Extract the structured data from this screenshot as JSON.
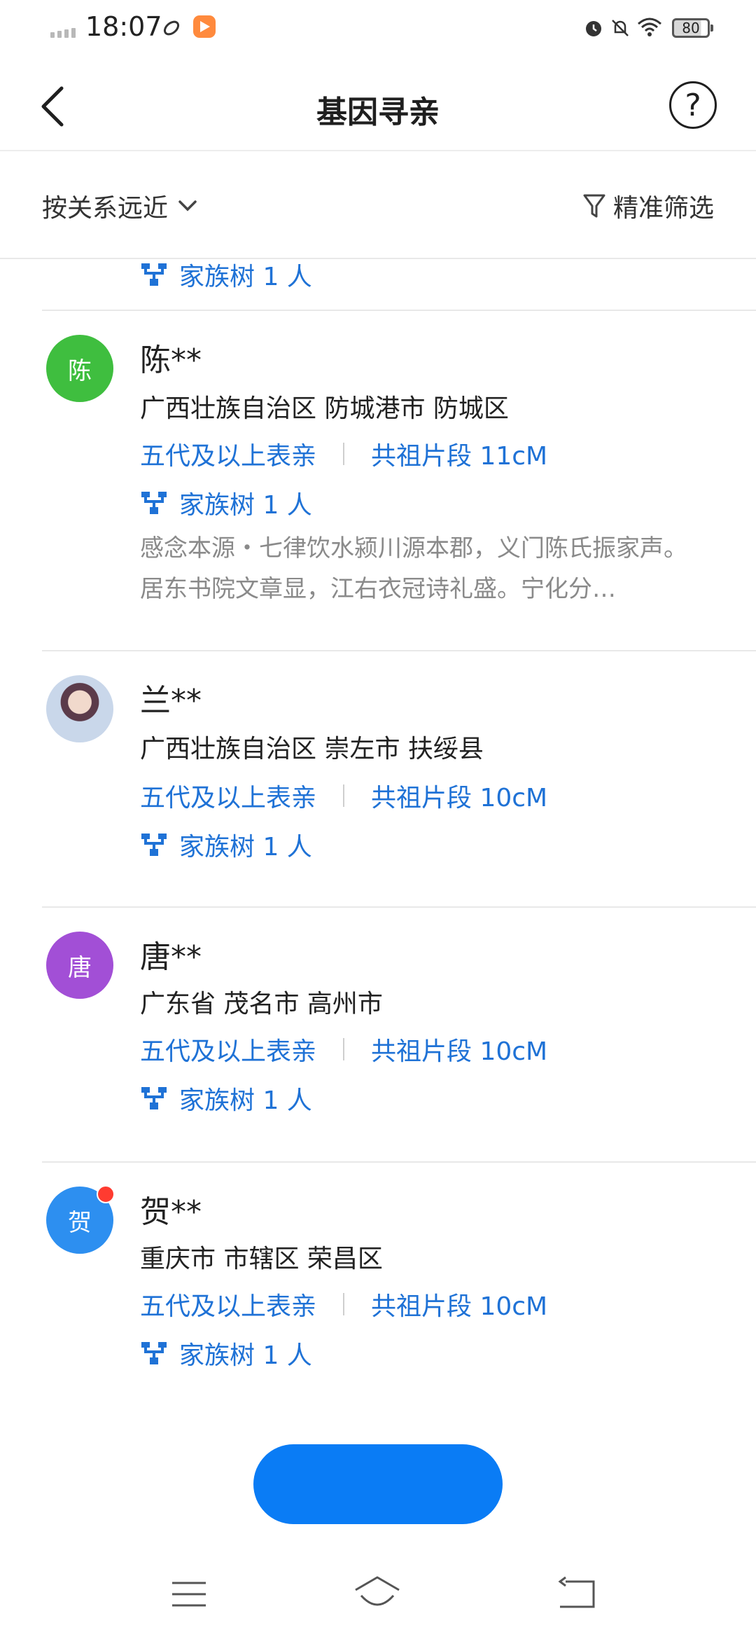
{
  "status_bar": {
    "time": "18:07",
    "battery": "80"
  },
  "header": {
    "title": "基因寻亲",
    "help": "?"
  },
  "filter_bar": {
    "sort_label": "按关系远近",
    "filter_label": "精准筛选"
  },
  "partial_row": {
    "tree_label": "家族树 1 人"
  },
  "matches": [
    {
      "avatar_text": "陈",
      "avatar_color": "#3fbe3f",
      "name": "陈**",
      "location": "广西壮族自治区 防城港市 防城区",
      "relation": "五代及以上表亲",
      "segment": "共祖片段 11cM",
      "tree": "家族树 1 人",
      "intro": "感念本源・七律饮水颍川源本郡，义门陈氏振家声。居东书院文章显，江右衣冠诗礼盛。宁化分…"
    },
    {
      "avatar_text": "",
      "avatar_color": "#c9d7ea",
      "name": "兰**",
      "location": "广西壮族自治区 崇左市 扶绥县",
      "relation": "五代及以上表亲",
      "segment": "共祖片段 10cM",
      "tree": "家族树 1 人"
    },
    {
      "avatar_text": "唐",
      "avatar_color": "#a24fd6",
      "name": "唐**",
      "location": "广东省 茂名市 高州市",
      "relation": "五代及以上表亲",
      "segment": "共祖片段 10cM",
      "tree": "家族树 1 人"
    },
    {
      "avatar_text": "贺",
      "avatar_color": "#2d8ff0",
      "name": "贺**",
      "location": "重庆市 市辖区 荣昌区",
      "relation": "五代及以上表亲",
      "segment": "共祖片段 10cM",
      "tree": "家族树 1 人"
    }
  ],
  "cta": {
    "label": "",
    "color": "#0a7cf5"
  },
  "colors": {
    "link_blue": "#1f72d6",
    "divider": "#e8e8e8"
  }
}
